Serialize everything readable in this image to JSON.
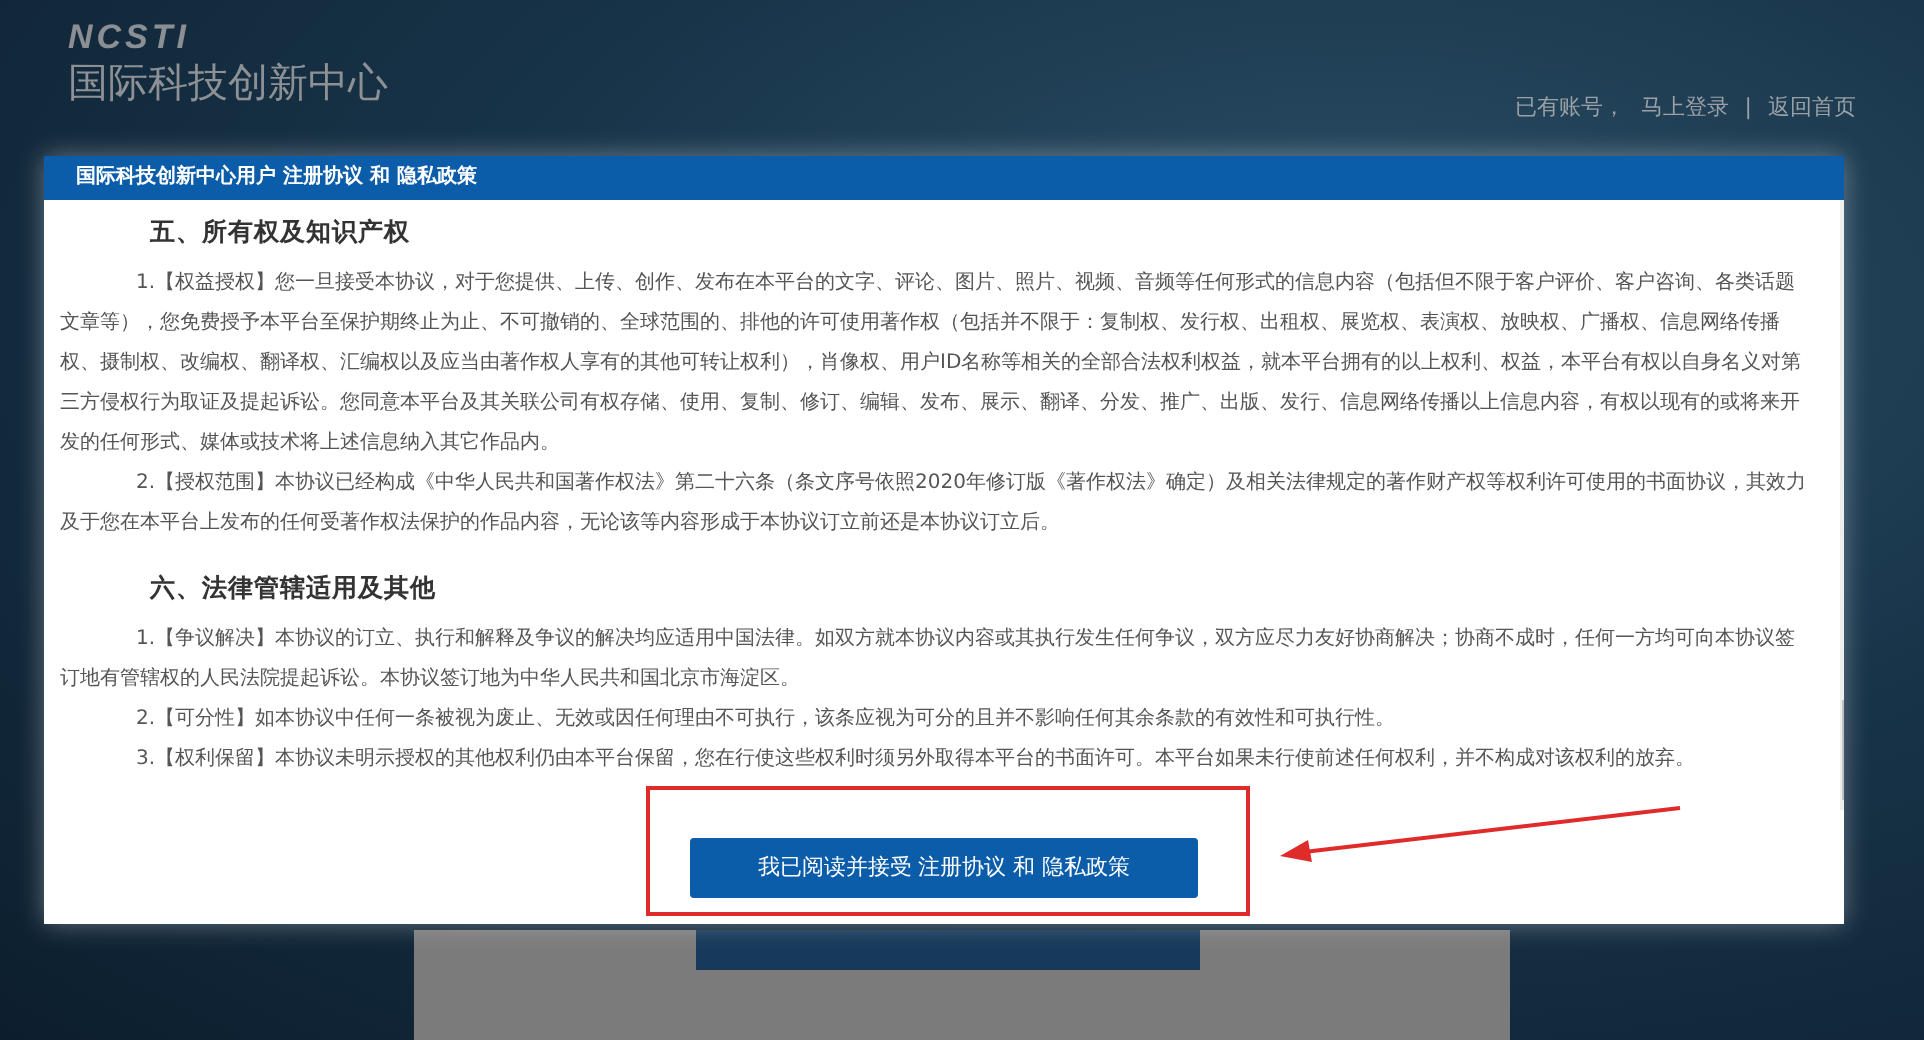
{
  "header": {
    "logo_mark": "NCSTI",
    "logo_text": "国际科技创新中心",
    "account_prompt": "已有账号，",
    "links": [
      {
        "label": "马上登录"
      },
      {
        "label": "返回首页"
      }
    ],
    "separator": "|"
  },
  "modal": {
    "title": "国际科技创新中心用户 注册协议 和 隐私政策",
    "sections": [
      {
        "heading": "五、所有权及知识产权",
        "paragraphs": [
          "1.【权益授权】您一旦接受本协议，对于您提供、上传、创作、发布在本平台的文字、评论、图片、照片、视频、音频等任何形式的信息内容（包括但不限于客户评价、客户咨询、各类话题文章等），您免费授予本平台至保护期终止为止、不可撤销的、全球范围的、排他的许可使用著作权（包括并不限于：复制权、发行权、出租权、展览权、表演权、放映权、广播权、信息网络传播权、摄制权、改编权、翻译权、汇编权以及应当由著作权人享有的其他可转让权利），肖像权、用户ID名称等相关的全部合法权利权益，就本平台拥有的以上权利、权益，本平台有权以自身名义对第三方侵权行为取证及提起诉讼。您同意本平台及其关联公司有权存储、使用、复制、修订、编辑、发布、展示、翻译、分发、推广、出版、发行、信息网络传播以上信息内容，有权以现有的或将来开发的任何形式、媒体或技术将上述信息纳入其它作品内。",
          "2.【授权范围】本协议已经构成《中华人民共和国著作权法》第二十六条（条文序号依照2020年修订版《著作权法》确定）及相关法律规定的著作财产权等权利许可使用的书面协议，其效力及于您在本平台上发布的任何受著作权法保护的作品内容，无论该等内容形成于本协议订立前还是本协议订立后。"
        ]
      },
      {
        "heading": "六、法律管辖适用及其他",
        "paragraphs": [
          "1.【争议解决】本协议的订立、执行和解释及争议的解决均应适用中国法律。如双方就本协议内容或其执行发生任何争议，双方应尽力友好协商解决；协商不成时，任何一方均可向本协议签订地有管辖权的人民法院提起诉讼。本协议签订地为中华人民共和国北京市海淀区。",
          "2.【可分性】如本协议中任何一条被视为废止、无效或因任何理由不可执行，该条应视为可分的且并不影响任何其余条款的有效性和可执行性。",
          "3.【权利保留】本协议未明示授权的其他权利仍由本平台保留，您在行使这些权利时须另外取得本平台的书面许可。本平台如果未行使前述任何权利，并不构成对该权利的放弃。"
        ]
      }
    ],
    "accept_button": "我已阅读并接受 注册协议 和 隐私政策"
  }
}
